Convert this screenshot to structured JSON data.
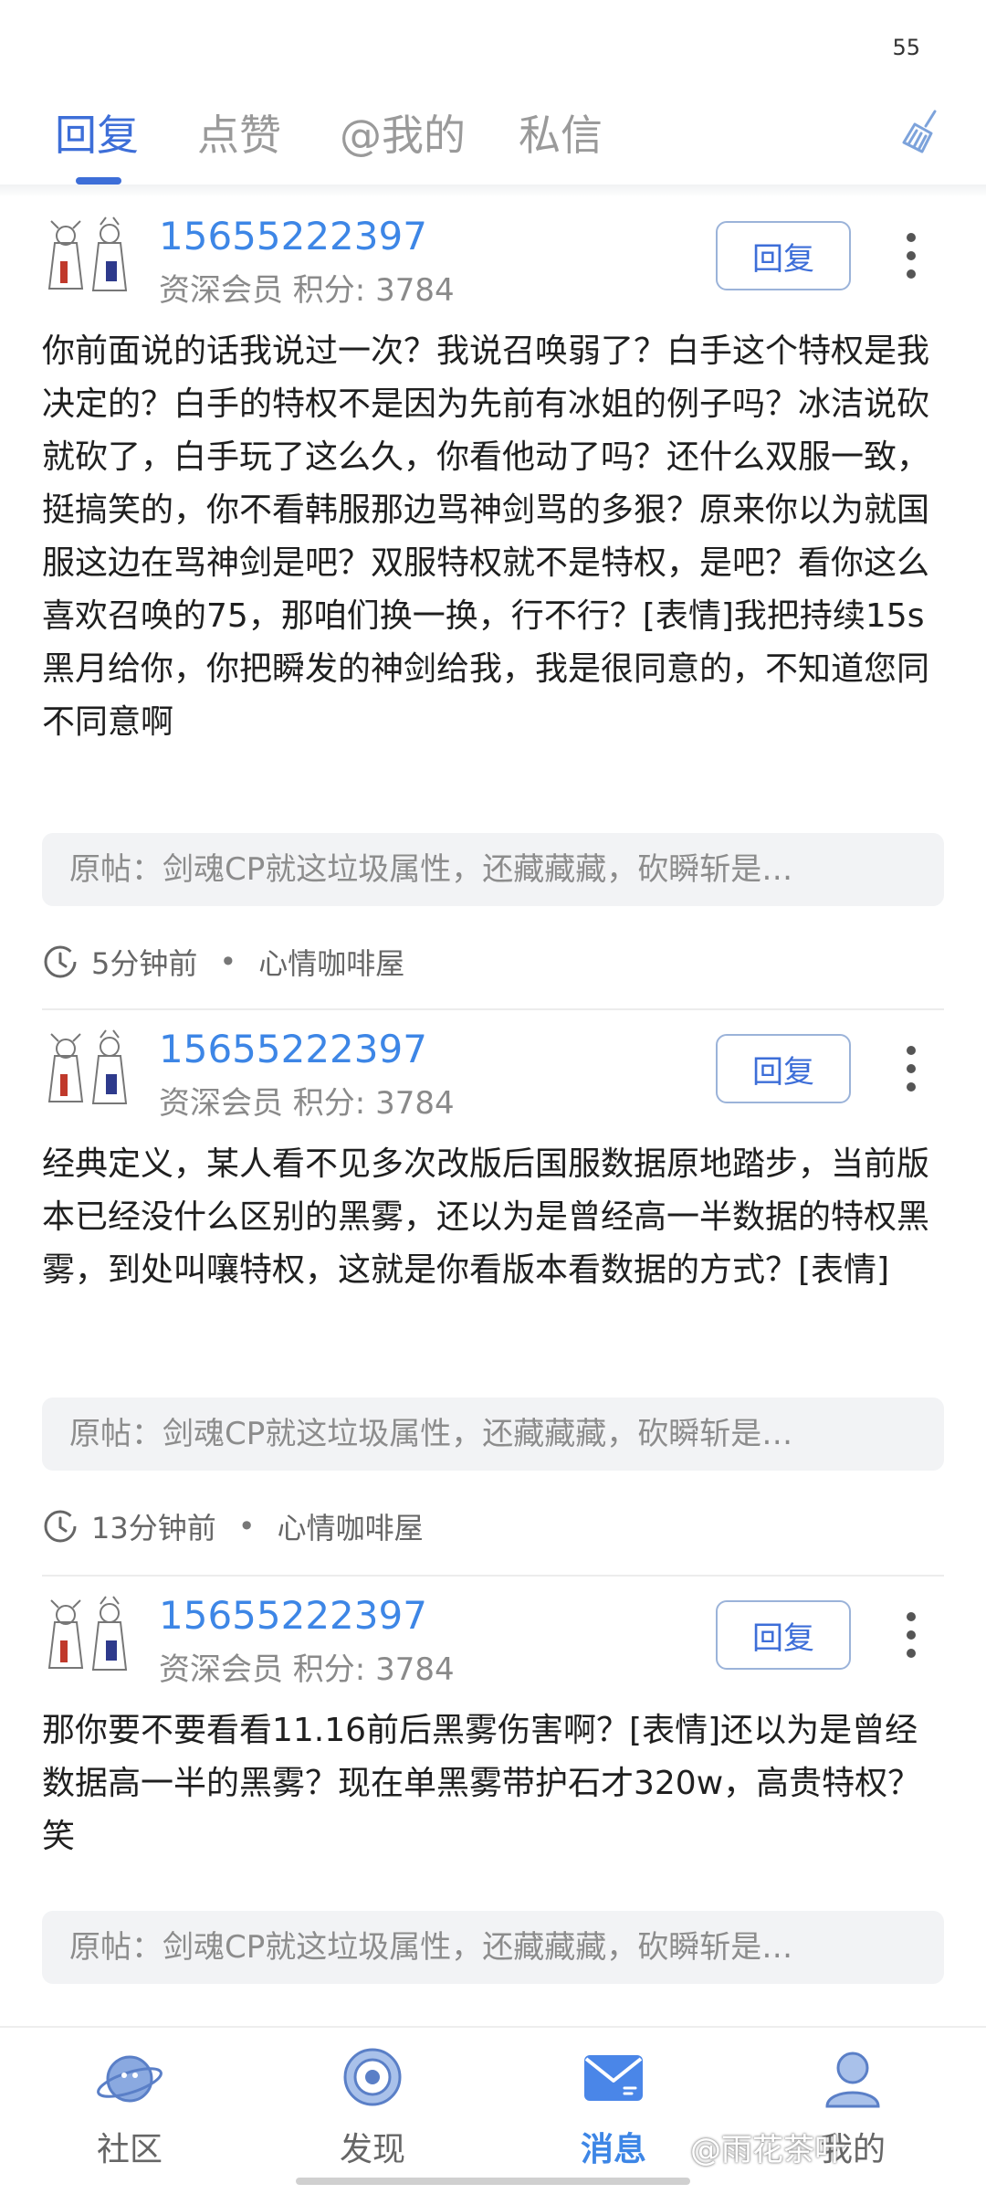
{
  "status_bar": {
    "number": "55"
  },
  "tabs": [
    {
      "label": "回复",
      "active": true
    },
    {
      "label": "点赞",
      "active": false
    },
    {
      "label": "@我的",
      "active": false
    },
    {
      "label": "私信",
      "active": false
    }
  ],
  "toolbar": {
    "clear_icon": "broom-icon"
  },
  "reply_label": "回复",
  "items": [
    {
      "username": "15655222397",
      "meta": "资深会员 积分: 3784",
      "content": "你前面说的话我说过一次？我说召唤弱了？白手这个特权是我决定的？白手的特权不是因为先前有冰姐的例子吗？冰洁说砍就砍了，白手玩了这么久，你看他动了吗？还什么双服一致，挺搞笑的，你不看韩服那边骂神剑骂的多狠？原来你以为就国服这边在骂神剑是吧？双服特权就不是特权，是吧？看你这么喜欢召唤的75，那咱们换一换，行不行？[表情]我把持续15s黑月给你，你把瞬发的神剑给我，我是很同意的，不知道您同不同意啊",
      "origin": "原帖：剑魂CP就这垃圾属性，还藏藏藏，砍瞬斩是…",
      "time": "5分钟前",
      "bar": "心情咖啡屋"
    },
    {
      "username": "15655222397",
      "meta": "资深会员 积分: 3784",
      "content": "经典定义，某人看不见多次改版后国服数据原地踏步，当前版本已经没什么区别的黑雾，还以为是曾经高一半数据的特权黑雾，到处叫嚷特权，这就是你看版本看数据的方式？[表情]",
      "origin": "原帖：剑魂CP就这垃圾属性，还藏藏藏，砍瞬斩是…",
      "time": "13分钟前",
      "bar": "心情咖啡屋"
    },
    {
      "username": "15655222397",
      "meta": "资深会员 积分: 3784",
      "content": "那你要不要看看11.16前后黑雾伤害啊？[表情]还以为是曾经数据高一半的黑雾？现在单黑雾带护石才320w，高贵特权？笑",
      "origin": "原帖：剑魂CP就这垃圾属性，还藏藏藏，砍瞬斩是…"
    }
  ],
  "bottom_nav": [
    {
      "label": "社区",
      "icon": "planet-icon",
      "active": false
    },
    {
      "label": "发现",
      "icon": "target-icon",
      "active": false
    },
    {
      "label": "消息",
      "icon": "mail-icon",
      "active": true
    },
    {
      "label": "我的",
      "icon": "user-icon",
      "active": false
    }
  ],
  "watermark": "@雨花茶叶",
  "colors": {
    "accent": "#3d6ed8",
    "link": "#3d86e6",
    "muted": "#8a8a8a"
  }
}
